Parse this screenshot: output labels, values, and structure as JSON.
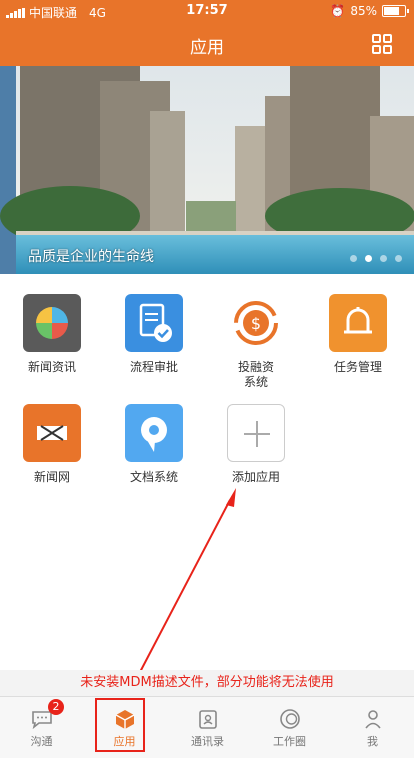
{
  "status_bar": {
    "carrier": "中国联通",
    "network": "4G",
    "time": "17:57",
    "battery": "85%",
    "battery_level": 0.85
  },
  "header": {
    "title": "应用"
  },
  "banner": {
    "caption": "品质是企业的生命线",
    "page_count": 4,
    "active_page": 2
  },
  "apps": [
    {
      "label": "新闻资讯",
      "icon": "news-info-icon",
      "color": "#5a5a5a"
    },
    {
      "label": "流程审批",
      "icon": "approval-flow-icon",
      "color": "#3a8fe0"
    },
    {
      "label": "投融资\n系统",
      "icon": "investment-icon",
      "color": "#e8742a"
    },
    {
      "label": "任务管理",
      "icon": "task-bell-icon",
      "color": "#f0922e"
    },
    {
      "label": "新闻网",
      "icon": "news-net-icon",
      "color": "#e8742a"
    },
    {
      "label": "文档系统",
      "icon": "document-system-icon",
      "color": "#52a8f0"
    },
    {
      "label": "添加应用",
      "icon": "add-app-icon",
      "color": "#ffffff"
    }
  ],
  "warning": "未安装MDM描述文件，部分功能将无法使用",
  "tabs": [
    {
      "label": "沟通",
      "icon": "chat-icon",
      "badge": "2"
    },
    {
      "label": "应用",
      "icon": "apps-box-icon",
      "active": true
    },
    {
      "label": "通讯录",
      "icon": "contacts-icon"
    },
    {
      "label": "工作圈",
      "icon": "work-circle-icon"
    },
    {
      "label": "我",
      "icon": "profile-icon"
    }
  ],
  "colors": {
    "brand": "#e8742a",
    "alert": "#e8231a"
  }
}
